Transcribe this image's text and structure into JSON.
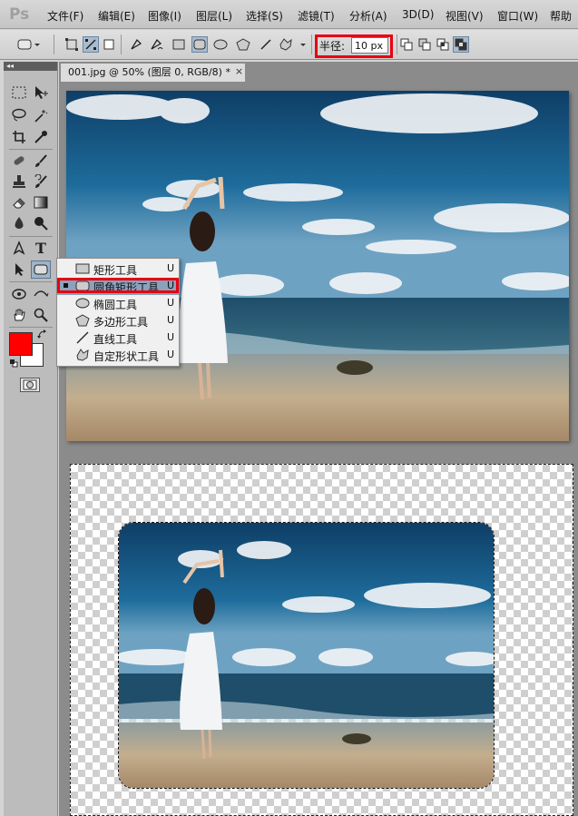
{
  "app": {
    "logo": "Ps"
  },
  "menu": [
    "文件(F)",
    "编辑(E)",
    "图像(I)",
    "图层(L)",
    "选择(S)",
    "滤镜(T)",
    "分析(A)",
    "3D(D)",
    "视图(V)",
    "窗口(W)",
    "帮助"
  ],
  "options": {
    "radius_label": "半径:",
    "radius_value": "10 px"
  },
  "document": {
    "tab_title": "001.jpg @ 50% (图层 0, RGB/8) *",
    "close_glyph": "×"
  },
  "tools_panel": {
    "collapse_glyph": "◂◂"
  },
  "flyout": {
    "items": [
      {
        "label": "矩形工具",
        "key": "U",
        "icon": "rectangle-icon"
      },
      {
        "label": "圆角矩形工具",
        "key": "U",
        "icon": "rounded-rectangle-icon",
        "selected": true
      },
      {
        "label": "椭圆工具",
        "key": "U",
        "icon": "ellipse-icon"
      },
      {
        "label": "多边形工具",
        "key": "U",
        "icon": "polygon-icon"
      },
      {
        "label": "直线工具",
        "key": "U",
        "icon": "line-icon"
      },
      {
        "label": "自定形状工具",
        "key": "U",
        "icon": "custom-shape-icon"
      }
    ]
  },
  "colors": {
    "foreground": "#ff0000",
    "background": "#ffffff",
    "highlight": "#e60012"
  }
}
